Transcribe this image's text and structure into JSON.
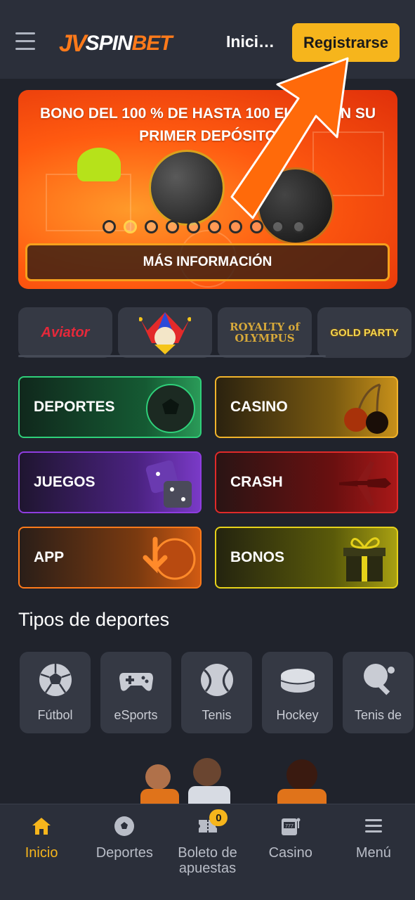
{
  "header": {
    "logo_mark": "JV",
    "logo_text_a": "SPIN",
    "logo_text_b": "BET",
    "login_label": "Inici…",
    "register_label": "Registrarse"
  },
  "banner": {
    "title": "BONO DEL 100 % DE HASTA 100 EUROS EN SU PRIMER DEPÓSITO",
    "more_label": "MÁS INFORMACIÓN",
    "slide_count": 10,
    "active_slide": 2
  },
  "games": [
    {
      "name": "Aviator"
    },
    {
      "name": "Joker"
    },
    {
      "name": "ROYALTY of OLYMPUS"
    },
    {
      "name": "GOLD PARTY"
    }
  ],
  "categories": {
    "deportes": "DEPORTES",
    "casino": "CASINO",
    "juegos": "JUEGOS",
    "crash": "CRASH",
    "app": "APP",
    "bonos": "BONOS"
  },
  "sports_section": {
    "title": "Tipos de deportes",
    "items": [
      {
        "label": "Fútbol",
        "icon": "soccer-ball-icon"
      },
      {
        "label": "eSports",
        "icon": "gamepad-icon"
      },
      {
        "label": "Tenis",
        "icon": "tennis-ball-icon"
      },
      {
        "label": "Hockey",
        "icon": "hockey-puck-icon"
      },
      {
        "label": "Tenis de",
        "icon": "table-tennis-icon"
      }
    ]
  },
  "bottom_nav": {
    "items": [
      {
        "label": "Inicio",
        "icon": "home-icon"
      },
      {
        "label": "Deportes",
        "icon": "soccer-ball-icon"
      },
      {
        "label": "Boleto de apuestas",
        "icon": "ticket-icon"
      },
      {
        "label": "Casino",
        "icon": "slot-machine-icon"
      },
      {
        "label": "Menú",
        "icon": "menu-icon"
      }
    ],
    "bet_count": "0"
  },
  "colors": {
    "accent": "#f6b51c",
    "brand_orange": "#ff7a1a",
    "background": "#20232c",
    "header": "#2b2f3a"
  }
}
